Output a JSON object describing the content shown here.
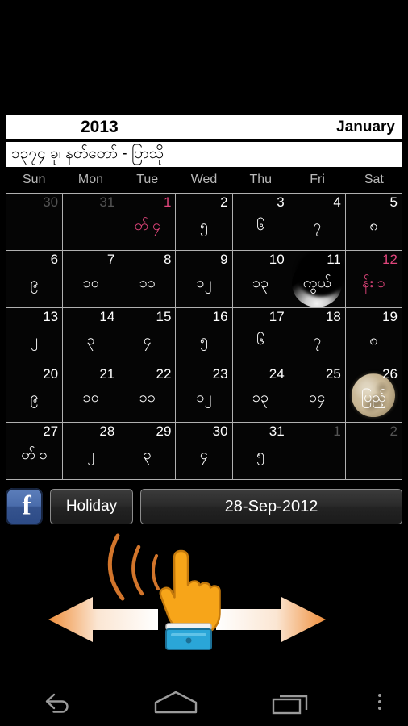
{
  "header": {
    "year": "2013",
    "month": "January",
    "myanmar_year_line": "၁၃၇၄ ခု၊ နတ်တော် - ပြာသို"
  },
  "weekdays": [
    "Sun",
    "Mon",
    "Tue",
    "Wed",
    "Thu",
    "Fri",
    "Sat"
  ],
  "colors": {
    "holiday": "#e0457b",
    "bar_background": "#ffffff",
    "page_background": "#000000",
    "grid_line": "#b0b0b0",
    "weekday_text": "#b9b9b9",
    "dim_day": "#545454",
    "full_moon": "#c6b492",
    "facebook_blue": "#3b5998"
  },
  "cells": [
    {
      "g": "30",
      "m": "",
      "dim": true,
      "holiday": false,
      "moon": ""
    },
    {
      "g": "31",
      "m": "",
      "dim": true,
      "holiday": false,
      "moon": ""
    },
    {
      "g": "1",
      "m": "တ် ၄",
      "dim": false,
      "holiday": true,
      "moon": ""
    },
    {
      "g": "2",
      "m": "၅",
      "dim": false,
      "holiday": false,
      "moon": ""
    },
    {
      "g": "3",
      "m": "၆",
      "dim": false,
      "holiday": false,
      "moon": ""
    },
    {
      "g": "4",
      "m": "၇",
      "dim": false,
      "holiday": false,
      "moon": ""
    },
    {
      "g": "5",
      "m": "၈",
      "dim": false,
      "holiday": false,
      "moon": ""
    },
    {
      "g": "6",
      "m": "၉",
      "dim": false,
      "holiday": false,
      "moon": ""
    },
    {
      "g": "7",
      "m": "၁၀",
      "dim": false,
      "holiday": false,
      "moon": ""
    },
    {
      "g": "8",
      "m": "၁၁",
      "dim": false,
      "holiday": false,
      "moon": ""
    },
    {
      "g": "9",
      "m": "၁၂",
      "dim": false,
      "holiday": false,
      "moon": ""
    },
    {
      "g": "10",
      "m": "၁၃",
      "dim": false,
      "holiday": false,
      "moon": ""
    },
    {
      "g": "11",
      "m": "ကွယ်",
      "dim": false,
      "holiday": false,
      "moon": "waning"
    },
    {
      "g": "12",
      "m": "န်း ၁",
      "dim": false,
      "holiday": true,
      "moon": ""
    },
    {
      "g": "13",
      "m": "၂",
      "dim": false,
      "holiday": false,
      "moon": ""
    },
    {
      "g": "14",
      "m": "၃",
      "dim": false,
      "holiday": false,
      "moon": ""
    },
    {
      "g": "15",
      "m": "၄",
      "dim": false,
      "holiday": false,
      "moon": ""
    },
    {
      "g": "16",
      "m": "၅",
      "dim": false,
      "holiday": false,
      "moon": ""
    },
    {
      "g": "17",
      "m": "၆",
      "dim": false,
      "holiday": false,
      "moon": ""
    },
    {
      "g": "18",
      "m": "၇",
      "dim": false,
      "holiday": false,
      "moon": ""
    },
    {
      "g": "19",
      "m": "၈",
      "dim": false,
      "holiday": false,
      "moon": ""
    },
    {
      "g": "20",
      "m": "၉",
      "dim": false,
      "holiday": false,
      "moon": ""
    },
    {
      "g": "21",
      "m": "၁၀",
      "dim": false,
      "holiday": false,
      "moon": ""
    },
    {
      "g": "22",
      "m": "၁၁",
      "dim": false,
      "holiday": false,
      "moon": ""
    },
    {
      "g": "23",
      "m": "၁၂",
      "dim": false,
      "holiday": false,
      "moon": ""
    },
    {
      "g": "24",
      "m": "၁၃",
      "dim": false,
      "holiday": false,
      "moon": ""
    },
    {
      "g": "25",
      "m": "၁၄",
      "dim": false,
      "holiday": false,
      "moon": ""
    },
    {
      "g": "26",
      "m": "ပြည့်",
      "dim": false,
      "holiday": false,
      "moon": "full"
    },
    {
      "g": "27",
      "m": "တ် ၁",
      "dim": false,
      "holiday": false,
      "moon": ""
    },
    {
      "g": "28",
      "m": "၂",
      "dim": false,
      "holiday": false,
      "moon": ""
    },
    {
      "g": "29",
      "m": "၃",
      "dim": false,
      "holiday": false,
      "moon": ""
    },
    {
      "g": "30",
      "m": "၄",
      "dim": false,
      "holiday": false,
      "moon": ""
    },
    {
      "g": "31",
      "m": "၅",
      "dim": false,
      "holiday": false,
      "moon": ""
    },
    {
      "g": "1",
      "m": "",
      "dim": true,
      "holiday": false,
      "moon": ""
    },
    {
      "g": "2",
      "m": "",
      "dim": true,
      "holiday": false,
      "moon": ""
    }
  ],
  "toolbar": {
    "facebook_icon": "facebook-icon",
    "facebook_glyph": "f",
    "holiday_label": "Holiday",
    "date_label": "28-Sep-2012"
  },
  "hint": {
    "name": "swipe-gesture-hint",
    "left_arrow": "left-arrow",
    "right_arrow": "right-arrow",
    "hand": "pointing-hand-icon"
  },
  "navbar": {
    "back": "back-icon",
    "home": "home-icon",
    "recents": "recents-icon",
    "overflow": "overflow-menu-icon"
  }
}
